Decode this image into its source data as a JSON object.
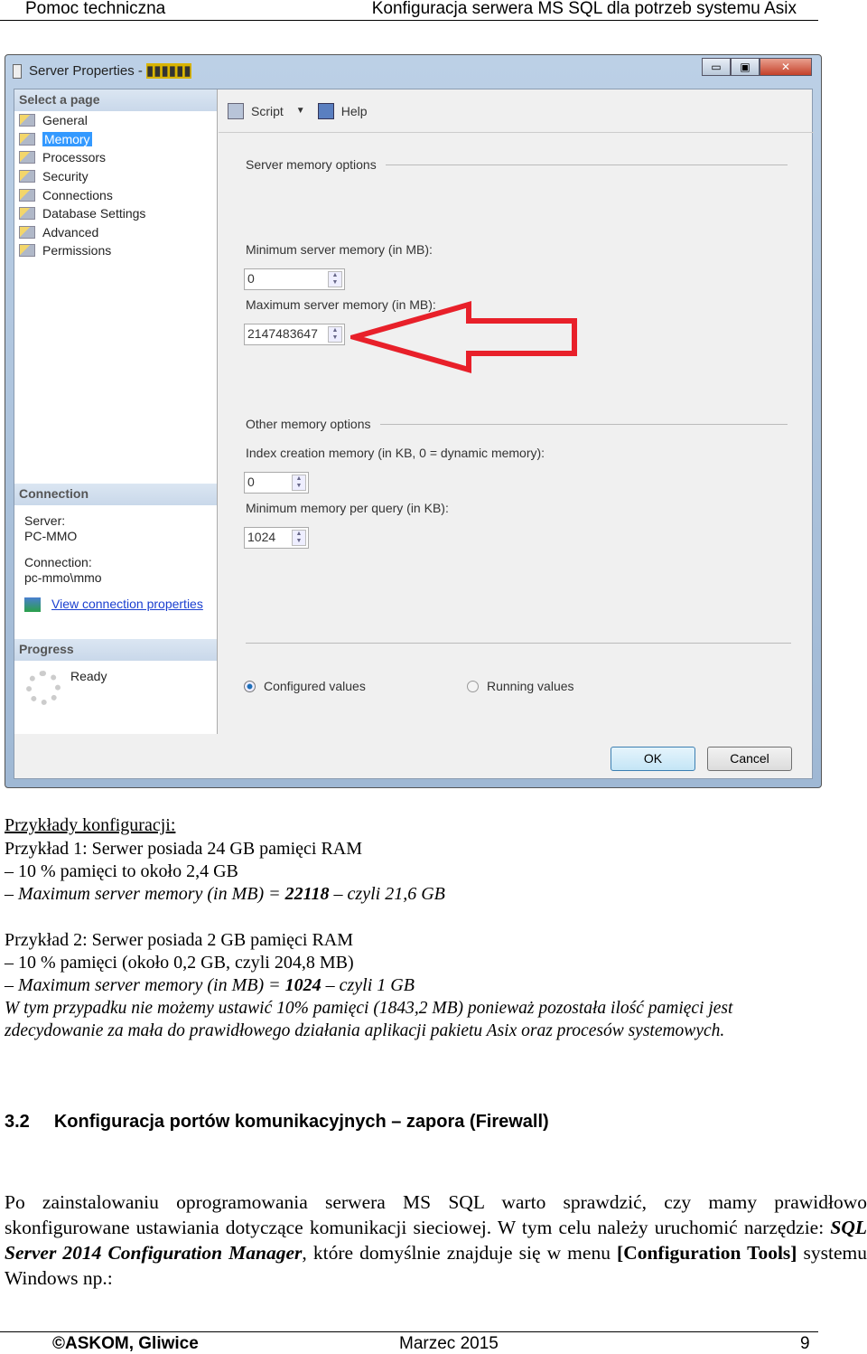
{
  "header": {
    "left": "Pomoc techniczna",
    "right": "Konfiguracja serwera MS SQL dla potrzeb systemu Asix"
  },
  "dialog": {
    "title": "Server Properties - ",
    "title_redacted": "▮▮▮▮▮▮",
    "controls": {
      "minimize": "▭",
      "maximize": "▣",
      "close": "✕"
    },
    "select_page": "Select a page",
    "pages": [
      "General",
      "Memory",
      "Processors",
      "Security",
      "Connections",
      "Database Settings",
      "Advanced",
      "Permissions"
    ],
    "selected_page": "Memory",
    "connection": {
      "heading": "Connection",
      "server_label": "Server:",
      "server": "PC-MMO",
      "connection_label": "Connection:",
      "connection": "pc-mmo\\mmo",
      "view_link": "View connection properties"
    },
    "progress": {
      "heading": "Progress",
      "status": "Ready"
    },
    "toolbar": {
      "script": "Script",
      "help": "Help"
    },
    "server_memory_options": "Server memory options",
    "min_label": "Minimum server memory (in MB):",
    "min_value": "0",
    "max_label": "Maximum server memory (in MB):",
    "max_value": "2147483647",
    "other_memory_options": "Other memory options",
    "index_label": "Index creation memory (in KB, 0 = dynamic memory):",
    "index_value": "0",
    "query_label": "Minimum memory per query (in KB):",
    "query_value": "1024",
    "radio_configured": "Configured values",
    "radio_running": "Running values",
    "radio_selected": "configured",
    "ok": "OK",
    "cancel": "Cancel",
    "arrow_color": "#e8202a"
  },
  "body": {
    "examples_title": "Przykłady konfiguracji:",
    "ex1_line1": "Przykład 1: Serwer posiada 24 GB pamięci RAM",
    "ex1_line2": "– 10 % pamięci to około 2,4 GB",
    "ex1_line3a": "– Maximum server memory (in MB) = ",
    "ex1_line3b": "22118",
    "ex1_line3c": " – czyli 21,6 GB",
    "ex2_line1": "Przykład 2: Serwer posiada 2 GB pamięci RAM",
    "ex2_line2": "– 10 % pamięci (około 0,2 GB, czyli 204,8 MB)",
    "ex2_line3a": "– Maximum server memory (in MB) = ",
    "ex2_line3b": "1024",
    "ex2_line3c": " – czyli 1 GB",
    "note1": "W tym przypadku nie możemy ustawić 10% pamięci (1843,2 MB) ponieważ pozostała ilość pamięci jest",
    "note2": "zdecydowanie za mała do prawidłowego działania aplikacji pakietu Asix oraz procesów systemowych.",
    "section_number": "3.2",
    "section_title": "Konfiguracja portów komunikacyjnych – zapora (Firewall)",
    "para_a": "Po zainstalowaniu oprogramowania serwera MS SQL warto sprawdzić, czy mamy prawidłowo skonfigurowane ustawiania dotyczące komunikacji sieciowej. W tym celu należy uruchomić narzędzie: ",
    "para_tool": "SQL Server 2014 Configuration Manager",
    "para_b": ", które domyślnie znajduje się w menu ",
    "para_menu": "[Configuration Tools]",
    "para_c": " systemu Windows np.:"
  },
  "footer": {
    "left": "©ASKOM, Gliwice",
    "center": "Marzec 2015",
    "page": "9"
  }
}
